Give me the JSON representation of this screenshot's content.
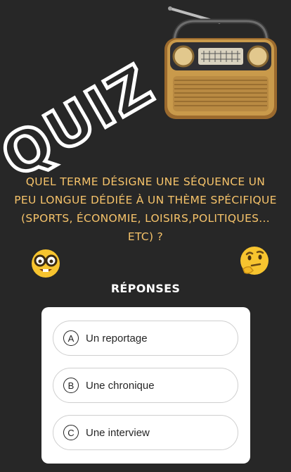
{
  "story": {
    "title": "QUIZ",
    "question": "Quel terme désigne une séquence un peu longue dédiée à un thème spécifique (sports, économie, loisirs,politiques... etc) ?",
    "responses_label": "RÉPONSES"
  },
  "quiz": {
    "options": [
      {
        "letter": "A",
        "text": "Un reportage"
      },
      {
        "letter": "B",
        "text": "Une chronique"
      },
      {
        "letter": "C",
        "text": "Une interview"
      }
    ]
  },
  "icons": {
    "radio": "radio-icon",
    "nerd": "nerd-face-emoji",
    "thinking": "thinking-face-emoji"
  },
  "colors": {
    "background": "#272727",
    "question_text": "#f6c36a",
    "card": "#ffffff"
  }
}
